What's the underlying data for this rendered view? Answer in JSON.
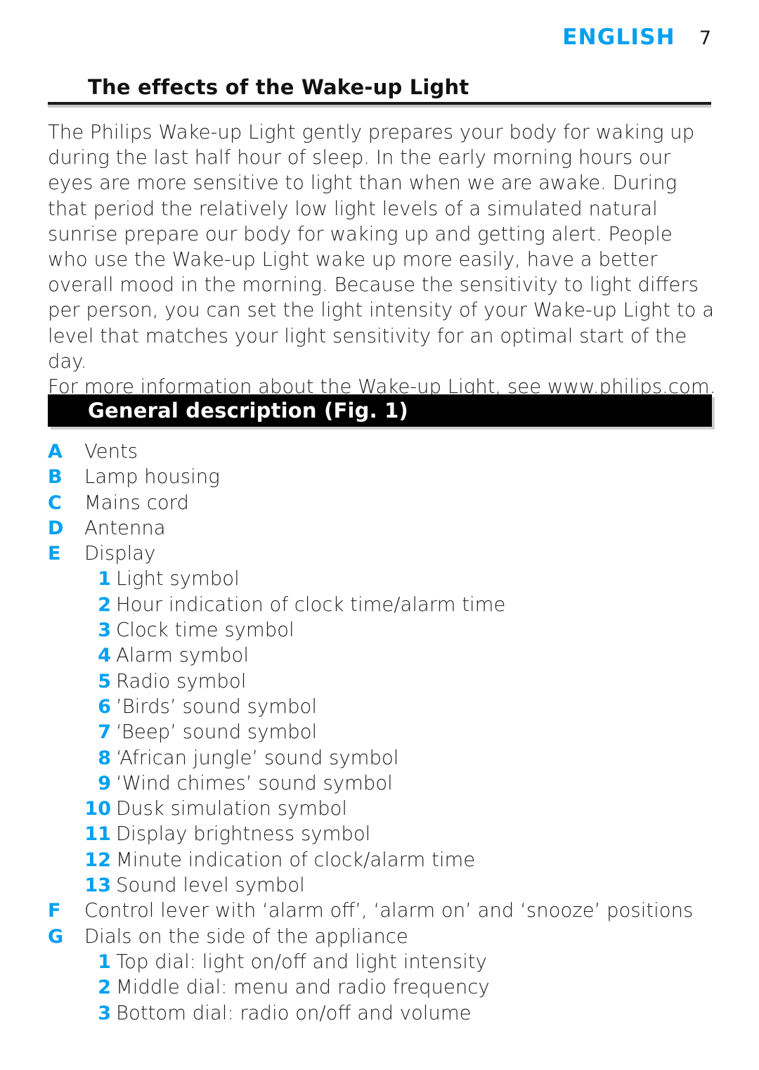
{
  "header": {
    "language": "ENGLISH",
    "page_number": "7"
  },
  "section": {
    "title": "The effects of the Wake-up Light",
    "paragraphs": [
      "The Philips Wake-up Light gently prepares your body for waking up during the last half hour of sleep. In the early morning hours our eyes are more sensitive to light than when we are awake. During that period the relatively low light levels of a simulated natural sunrise prepare our body for waking up and getting alert. People who use the Wake-up Light wake up more easily, have a better overall mood in the morning. Because the sensitivity to light differs per person, you can set the light intensity of your Wake-up Light to a level that matches your light sensitivity for an optimal start of the day.",
      "For more information about the Wake-up Light, see www.philips.com."
    ]
  },
  "banner": {
    "title": "General description (Fig. 1)"
  },
  "description_list": [
    {
      "level": "letter",
      "marker": "A",
      "label": "Vents"
    },
    {
      "level": "letter",
      "marker": "B",
      "label": "Lamp housing"
    },
    {
      "level": "letter",
      "marker": "C",
      "label": "Mains cord"
    },
    {
      "level": "letter",
      "marker": "D",
      "label": "Antenna"
    },
    {
      "level": "letter",
      "marker": "E",
      "label": "Display"
    },
    {
      "level": "number",
      "marker": "1",
      "label": "Light symbol"
    },
    {
      "level": "number",
      "marker": "2",
      "label": "Hour indication of clock time/alarm time"
    },
    {
      "level": "number",
      "marker": "3",
      "label": "Clock time symbol"
    },
    {
      "level": "number",
      "marker": "4",
      "label": "Alarm symbol"
    },
    {
      "level": "number",
      "marker": "5",
      "label": "Radio symbol"
    },
    {
      "level": "number",
      "marker": "6",
      "label": "’Birds’ sound symbol"
    },
    {
      "level": "number",
      "marker": "7",
      "label": "‘Beep’ sound symbol"
    },
    {
      "level": "number",
      "marker": "8",
      "label": "‘African jungle’ sound symbol"
    },
    {
      "level": "number",
      "marker": "9",
      "label": "‘Wind chimes’ sound symbol"
    },
    {
      "level": "number",
      "marker": "10",
      "label": "Dusk simulation symbol"
    },
    {
      "level": "number",
      "marker": "11",
      "label": "Display brightness symbol"
    },
    {
      "level": "number",
      "marker": "12",
      "label": "Minute indication of clock/alarm time"
    },
    {
      "level": "number",
      "marker": "13",
      "label": "Sound level symbol"
    },
    {
      "level": "letter",
      "marker": "F",
      "label": "Control lever with ‘alarm off’, ‘alarm on’ and ‘snooze’ positions"
    },
    {
      "level": "letter",
      "marker": "G",
      "label": "Dials on the side of the appliance"
    },
    {
      "level": "number",
      "marker": "1",
      "label": "Top dial: light on/off and light intensity"
    },
    {
      "level": "number",
      "marker": "2",
      "label": "Middle dial: menu and radio frequency"
    },
    {
      "level": "number",
      "marker": "3",
      "label": "Bottom dial: radio on/off and volume"
    }
  ],
  "colors": {
    "accent_blue": "#00a0f0",
    "banner_background": "#000000",
    "banner_text": "#ffffff",
    "body_text": "#1d1d1d"
  }
}
